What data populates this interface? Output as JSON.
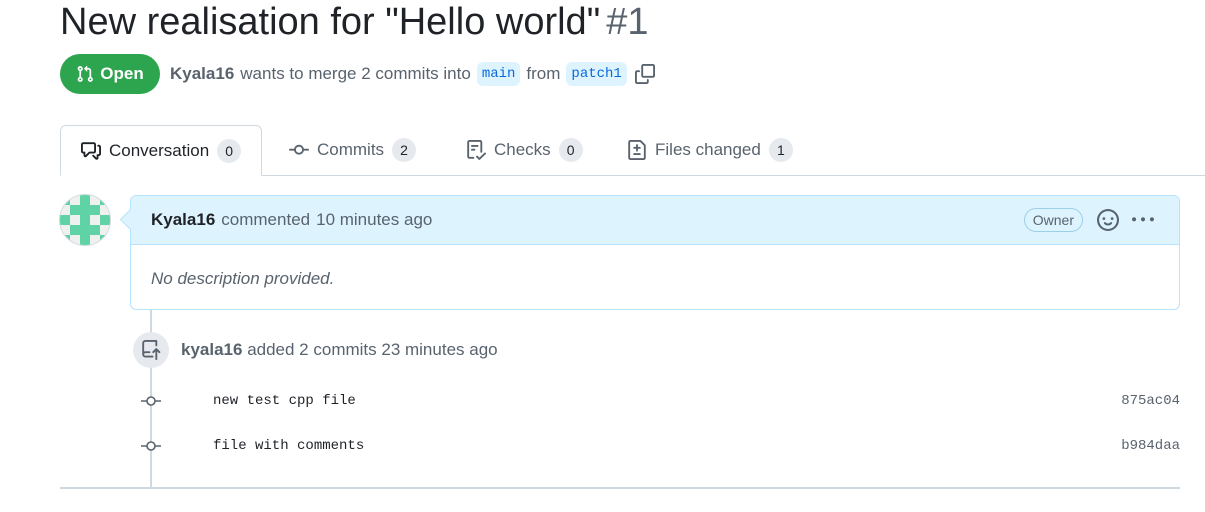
{
  "pr": {
    "title": "New realisation for \"Hello world\"",
    "number": "#1",
    "state": "Open",
    "author": "Kyala16",
    "merge_text": "wants to merge 2 commits into",
    "base_branch": "main",
    "from_text": "from",
    "head_branch": "patch1"
  },
  "tabs": [
    {
      "label": "Conversation",
      "count": "0",
      "icon": "comment-discussion-icon"
    },
    {
      "label": "Commits",
      "count": "2",
      "icon": "git-commit-icon"
    },
    {
      "label": "Checks",
      "count": "0",
      "icon": "checklist-icon"
    },
    {
      "label": "Files changed",
      "count": "1",
      "icon": "file-diff-icon"
    }
  ],
  "comment": {
    "author": "Kyala16",
    "action": "commented",
    "time": "10 minutes ago",
    "role": "Owner",
    "body": "No description provided."
  },
  "event": {
    "author": "kyala16",
    "text": "added 2 commits 23 minutes ago"
  },
  "commits": [
    {
      "message": "new test cpp file",
      "sha": "875ac04"
    },
    {
      "message": "file with comments",
      "sha": "b984daa"
    }
  ],
  "colors": {
    "open_green": "#2da44e",
    "link_blue": "#0969da",
    "comment_header_bg": "#ddf4ff",
    "avatar_teal": "#5fd3a5"
  }
}
